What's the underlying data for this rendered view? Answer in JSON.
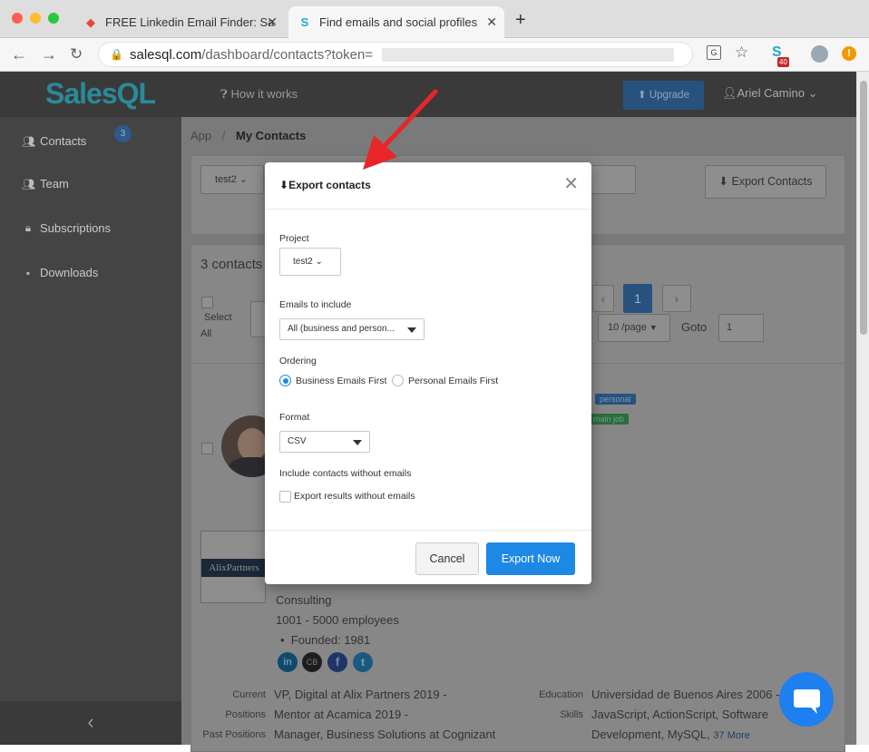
{
  "browser": {
    "tabs": [
      {
        "title": "FREE Linkedin Email Finder: Sa",
        "close": "✕"
      },
      {
        "title": "Find emails and social profiles",
        "close": "✕"
      }
    ],
    "new_tab": "+",
    "url_prefix": "salesql.com",
    "url_path": "/dashboard/contacts?token=",
    "extension_badge": "40"
  },
  "app": {
    "logo": "SalesQL",
    "how_it_works": "How it works",
    "upgrade": "Upgrade",
    "user": "Ariel Camino"
  },
  "sidebar": {
    "items": [
      {
        "label": "Contacts",
        "icon": "contacts-icon"
      },
      {
        "label": "Team",
        "icon": "team-icon"
      },
      {
        "label": "Subscriptions",
        "icon": "lock-icon"
      },
      {
        "label": "Downloads",
        "icon": "download-icon"
      }
    ],
    "contacts_badge": "3",
    "collapse": "‹"
  },
  "breadcrumb": {
    "root": "App",
    "sep": "/",
    "current": "My Contacts"
  },
  "toolbar": {
    "project": "test2",
    "export_contacts": "Export Contacts"
  },
  "contacts": {
    "count": "3 contacts",
    "select_label": "Select",
    "select_all": "All",
    "page_number": "1",
    "per_page": "10 /page",
    "goto_label": "Goto",
    "goto_value": "1",
    "tags": [
      "personal",
      "main job"
    ]
  },
  "profile": {
    "company_logo_text": "AlixPartners",
    "industry": "Consulting",
    "employees": "1001 - 5000 employees",
    "founded": "Founded: 1981",
    "social": [
      "in",
      "CB",
      "f",
      "t"
    ],
    "current_positions_label1": "Current",
    "current_positions_label2": "Positions",
    "past_positions_label": "Past Positions",
    "current_position1": "VP, Digital at Alix Partners 2019 -",
    "current_position2": "Mentor at Acamica 2019 -",
    "past_position": "Manager, Business Solutions at Cognizant",
    "education_label": "Education",
    "education": "Universidad de Buenos Aires 2006 -",
    "skills_label": "Skills",
    "skills1": "JavaScript, ActionScript, Software",
    "skills2": "Development, MySQL,",
    "skills_more": "37 More"
  },
  "modal": {
    "title": "Export contacts",
    "project_label": "Project",
    "project_value": "test2",
    "emails_label": "Emails to include",
    "emails_value": "All (business and person...",
    "ordering_label": "Ordering",
    "ordering_options": [
      "Business Emails First",
      "Personal Emails First"
    ],
    "ordering_selected": "Business Emails First",
    "format_label": "Format",
    "format_value": "CSV",
    "without_emails_label": "Include contacts without emails",
    "without_emails_checkbox": "Export results without emails",
    "cancel": "Cancel",
    "export_now": "Export Now"
  },
  "colors": {
    "accent": "#1e88e5",
    "arrow": "#e8262a",
    "topbar": "#3a3a3a"
  }
}
